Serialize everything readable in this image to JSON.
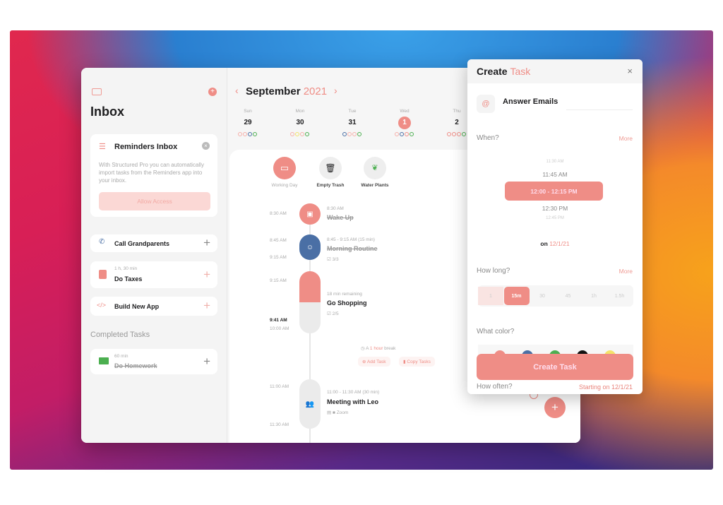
{
  "colors": {
    "accent": "#ef8d86",
    "blue": "#4a6fa5",
    "green": "#4caf50"
  },
  "sidebar": {
    "title": "Inbox",
    "reminders": {
      "title": "Reminders Inbox",
      "body": "With Structured Pro you can automatically import tasks from the Reminders app into your inbox.",
      "button": "Allow Access"
    },
    "tasks": [
      {
        "title": "Call Grandparents",
        "icon": "phone-icon"
      },
      {
        "meta": "1 h, 30 min",
        "title": "Do Taxes",
        "icon": "documents-icon"
      },
      {
        "title": "Build New App",
        "icon": "code-icon"
      }
    ],
    "completed_header": "Completed Tasks",
    "completed": [
      {
        "meta": "60 min",
        "title": "Do Homework",
        "icon": "book-icon"
      }
    ]
  },
  "calendar": {
    "month": "September",
    "year": "2021",
    "days": [
      {
        "dow": "Sun",
        "num": "29"
      },
      {
        "dow": "Mon",
        "num": "30"
      },
      {
        "dow": "Tue",
        "num": "31"
      },
      {
        "dow": "Wed",
        "num": "1",
        "selected": true
      },
      {
        "dow": "Thu",
        "num": "2"
      }
    ]
  },
  "allday": [
    {
      "label": "Working Day",
      "icon": "monitor-icon"
    },
    {
      "label": "Empty Trash",
      "icon": "trash-icon"
    },
    {
      "label": "Water Plants",
      "icon": "leaf-icon"
    }
  ],
  "timeline": {
    "labels": [
      "8:30 AM",
      "8:45 AM",
      "9:15 AM",
      "9:15 AM",
      "9:41 AM",
      "10:00 AM",
      "11:00 AM",
      "11:30 AM"
    ],
    "events": [
      {
        "time": "8:30 AM",
        "title": "Wake Up"
      },
      {
        "time": "8:45 - 9:15 AM (15 min)",
        "title": "Morning Routine",
        "sub": "3/3"
      },
      {
        "time": "18 min remaining",
        "title": "Go Shopping",
        "sub": "2/5"
      },
      {
        "time": "11:00 - 11:30 AM (30 min)",
        "title": "Meeting with Leo",
        "sub": "Zoom"
      }
    ],
    "break": {
      "pre": "A",
      "dur": "1 hour",
      "post": "break"
    },
    "add_task": "Add Task",
    "copy_tasks": "Copy Tasks"
  },
  "panel": {
    "title_a": "Create",
    "title_b": "Task",
    "task_name": "Answer Emails",
    "when": "When?",
    "more": "More",
    "times": [
      "11:30 AM",
      "11:45 AM",
      "12:00 - 12:15 PM",
      "12:30 PM",
      "12:45 PM"
    ],
    "on": "on",
    "date": "12/1/21",
    "how_long": "How long?",
    "durations": [
      "1",
      "15m",
      "30",
      "45",
      "1h",
      "1.5h"
    ],
    "selected_duration": "15m",
    "what_color": "What color?",
    "swatches": [
      "#ef8d86",
      "#4a6fa5",
      "#4caf50",
      "#111111",
      "#f4e36a"
    ],
    "create": "Create Task",
    "how_often": "How often?",
    "how_often_value": "Starting on 12/1/21"
  }
}
